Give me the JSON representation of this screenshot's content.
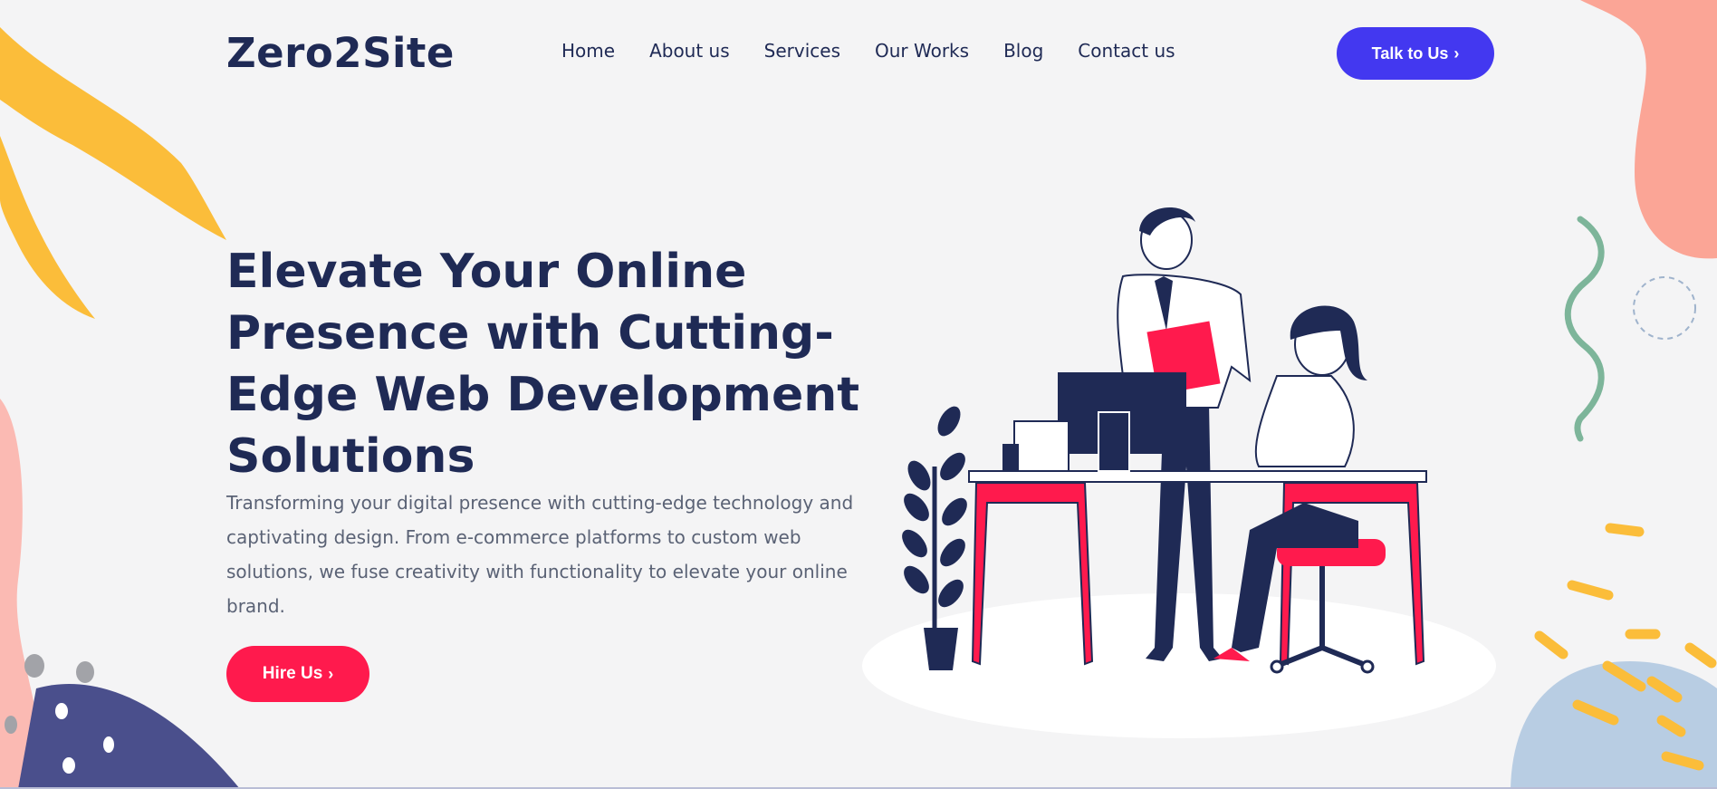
{
  "brand": {
    "logo": "Zero2Site"
  },
  "nav": {
    "items": [
      "Home",
      "About us",
      "Services",
      "Our Works",
      "Blog",
      "Contact us"
    ]
  },
  "header": {
    "cta_label": "Talk to Us",
    "cta_icon": "chevron-right-icon"
  },
  "hero": {
    "title": "Elevate Your Online Presence with Cutting-Edge Web Development Solutions",
    "description": "Transforming your digital presence with cutting-edge technology and captivating design. From e-commerce platforms to custom web solutions, we fuse creativity with functionality to elevate your online brand.",
    "cta_label": "Hire Us",
    "cta_icon": "chevron-right-icon"
  },
  "colors": {
    "primary_navy": "#1f2a55",
    "accent_blue": "#4338f0",
    "accent_red": "#ff1a4d",
    "background": "#f4f4f5",
    "deco_yellow": "#fbbd3a",
    "deco_salmon": "#fba596",
    "deco_green": "#7db59a",
    "deco_light_blue": "#b8cde3"
  }
}
